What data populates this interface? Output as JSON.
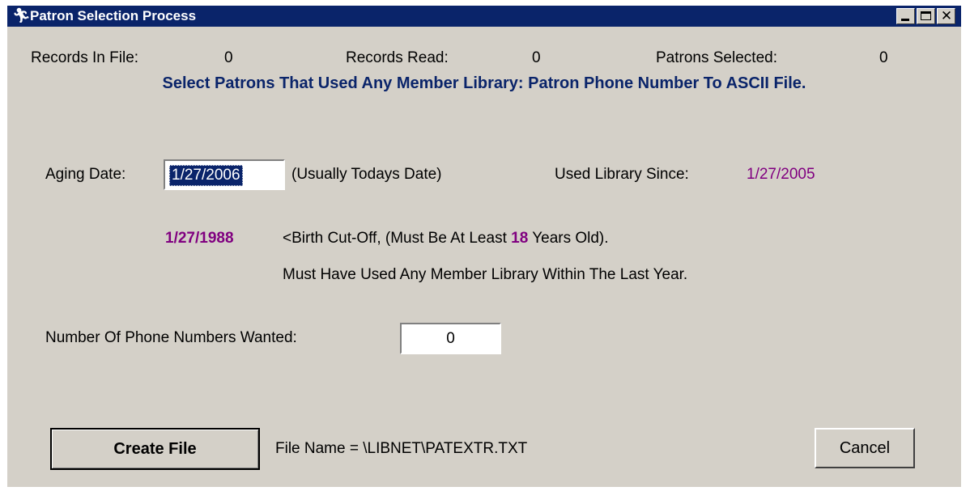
{
  "window": {
    "title": "Patron Selection Process",
    "icon": "running-figure-icon",
    "controls": {
      "minimize": "minimize",
      "maximize": "maximize",
      "close": "close"
    }
  },
  "stats": {
    "records_in_file_label": "Records In File:",
    "records_in_file_value": "0",
    "records_read_label": "Records Read:",
    "records_read_value": "0",
    "patrons_selected_label": "Patrons Selected:",
    "patrons_selected_value": "0"
  },
  "heading": "Select Patrons That Used Any Member Library: Patron Phone Number To ASCII File.",
  "aging": {
    "label": "Aging Date:",
    "value": "1/27/2006",
    "hint": "(Usually Todays Date)",
    "used_since_label": "Used Library Since:",
    "used_since_value": "1/27/2005"
  },
  "birth": {
    "date": "1/27/1988",
    "text_before": "<Birth Cut-Off, (Must Be At Least ",
    "age": "18",
    "text_after": " Years Old).",
    "requirement": "Must Have Used Any Member Library Within The Last Year."
  },
  "phones": {
    "label": "Number Of Phone Numbers Wanted:",
    "value": "0"
  },
  "actions": {
    "create_label": "Create File",
    "file_name": "File Name = \\LIBNET\\PATEXTR.TXT",
    "cancel_label": "Cancel"
  },
  "colors": {
    "title_bar": "#0a246a",
    "dialog_bg": "#d4d0c8",
    "heading": "#0a246a",
    "date_accent": "#800080"
  }
}
